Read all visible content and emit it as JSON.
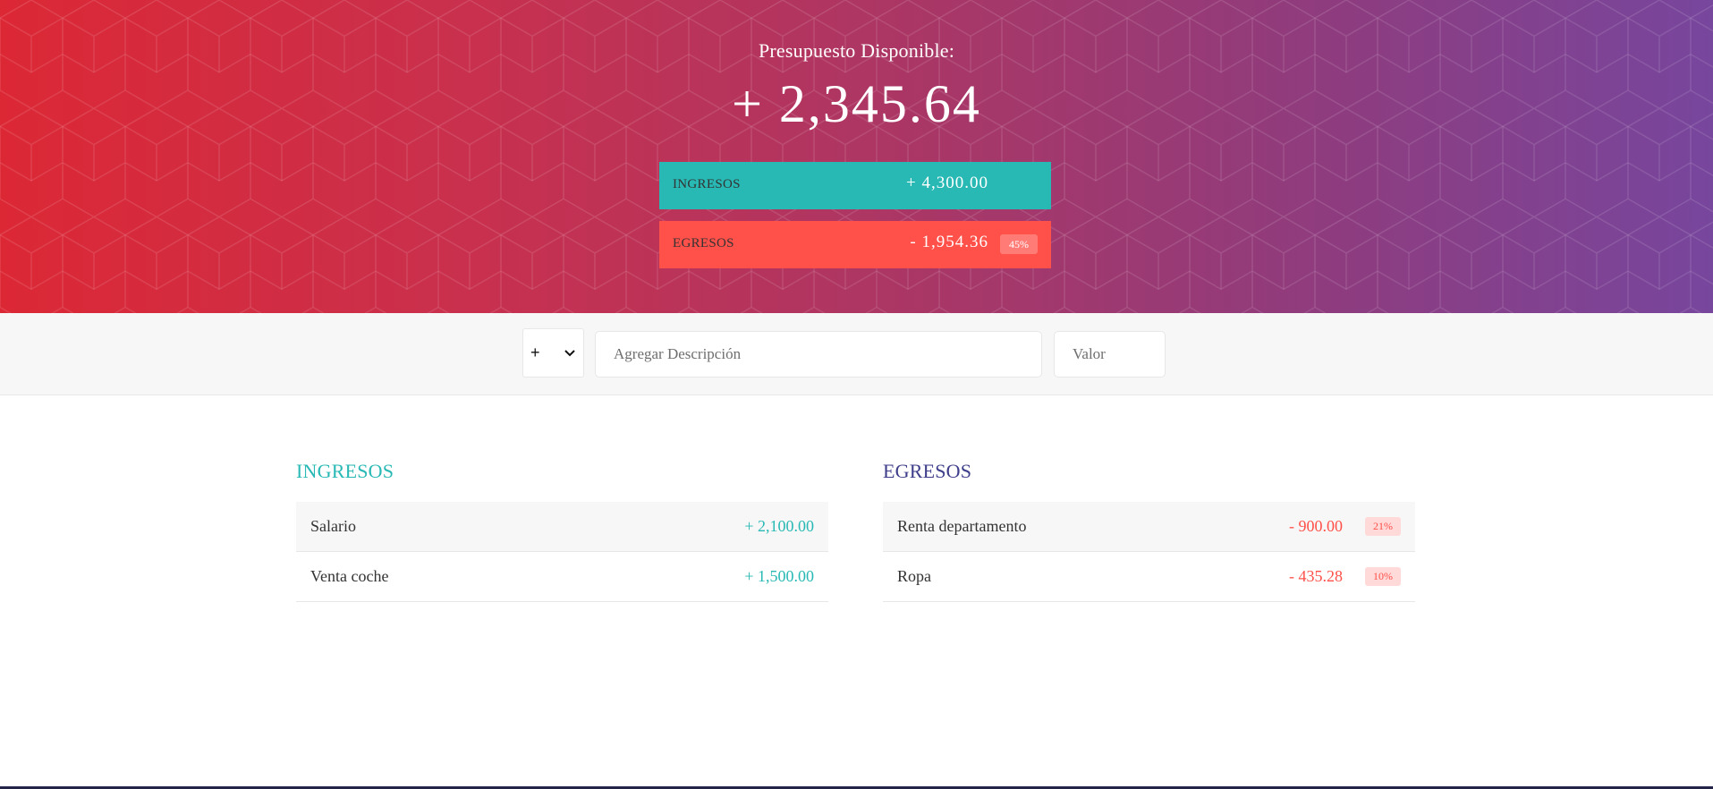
{
  "header": {
    "title": "Presupuesto Disponible:",
    "total": "+ 2,345.64",
    "income": {
      "label": "INGRESOS",
      "value": "+ 4,300.00",
      "color": "#28b9b5"
    },
    "expense": {
      "label": "EGRESOS",
      "value": "- 1,954.36",
      "percentage": "45%",
      "color": "#ff5049"
    }
  },
  "add_bar": {
    "type_selected": "+",
    "description_placeholder": "Agregar Descripción",
    "value_placeholder": "Valor"
  },
  "income_list": {
    "title": "INGRESOS",
    "items": [
      {
        "description": "Salario",
        "value": "+ 2,100.00"
      },
      {
        "description": "Venta coche",
        "value": "+ 1,500.00"
      }
    ]
  },
  "expense_list": {
    "title": "EGRESOS",
    "items": [
      {
        "description": "Renta departamento",
        "value": "- 900.00",
        "percentage": "21%"
      },
      {
        "description": "Ropa",
        "value": "- 435.28",
        "percentage": "10%"
      }
    ]
  },
  "icons": {
    "select_arrow": "chevron-down-icon"
  }
}
